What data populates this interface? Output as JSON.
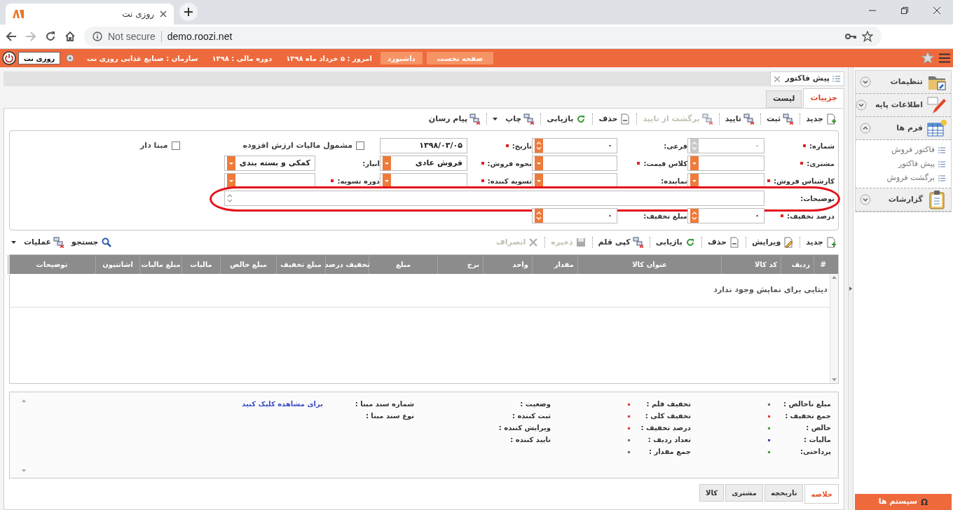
{
  "browser": {
    "tab_title": "روزی نت",
    "security": "Not secure",
    "url": "demo.roozi.net"
  },
  "header": {
    "nav_buttons": [
      {
        "label": "صفحه نخست"
      },
      {
        "label": "داشبورد"
      }
    ],
    "info": [
      "امروز : ۵ خرداد ماه ۱۳۹۸",
      "دوره مالی : ۱۳۹۸",
      "سازمان : صنایع غذایی روزی نت"
    ],
    "user": "روزی نت"
  },
  "document_tab": {
    "title": "پیش فاکتور"
  },
  "view_tabs": [
    {
      "label": "جزییات",
      "selected": true
    },
    {
      "label": "لیست",
      "selected": false
    }
  ],
  "toolbar": [
    {
      "label": "جدید",
      "kind": "new",
      "disabled": false,
      "dropdown": false
    },
    {
      "label": "ثبت",
      "kind": "network",
      "disabled": false,
      "dropdown": false
    },
    {
      "label": "تایید",
      "kind": "network",
      "disabled": false,
      "dropdown": false
    },
    {
      "label": "برگشت از تایید",
      "kind": "network",
      "disabled": true,
      "dropdown": false
    },
    {
      "label": "حذف",
      "kind": "delete",
      "disabled": false,
      "dropdown": false
    },
    {
      "label": "بازیابی",
      "kind": "refresh",
      "disabled": false,
      "dropdown": false
    },
    {
      "label": "چاپ",
      "kind": "network",
      "disabled": false,
      "dropdown": true
    },
    {
      "label": "پیام رسان",
      "kind": "network",
      "disabled": false,
      "dropdown": false
    }
  ],
  "form": {
    "rows": [
      [
        {
          "label": "شماره:",
          "required": true,
          "kind": "number",
          "value": "۰",
          "disabled": true
        },
        {
          "label": "فرعی:",
          "required": false,
          "kind": "number",
          "value": "۰",
          "disabled": false
        },
        {
          "label": "تاریخ:",
          "required": true,
          "kind": "date",
          "value": "۱۳۹۸/۰۳/۰۵"
        },
        {
          "kind": "checkbox",
          "label": "مشمول مالیات ارزش افزوده",
          "checked": false
        },
        {
          "kind": "checkbox",
          "label": "مبنا دار",
          "checked": false
        }
      ],
      [
        {
          "label": "مشتری:",
          "required": true,
          "kind": "combo"
        },
        {
          "label": "کلاس قیمت:",
          "required": true,
          "kind": "combo"
        },
        {
          "label": "نحوه فروش:",
          "required": true,
          "kind": "combo",
          "value": "فروش عادی"
        },
        {
          "label": "انبار:",
          "required": false,
          "kind": "combo",
          "value": "کمکی و بسته بندی"
        }
      ],
      [
        {
          "label": "کارشناس فروش:",
          "required": true,
          "kind": "combo"
        },
        {
          "label": "نماینده:",
          "required": false,
          "kind": "combo"
        },
        {
          "label": "تسویه کننده:",
          "required": true,
          "kind": "combo"
        },
        {
          "label": "دوره تسویه:",
          "required": true,
          "kind": "combo"
        }
      ],
      [
        {
          "label": "توضیحات:",
          "required": false,
          "kind": "textarea"
        }
      ],
      [
        {
          "label": "درصد تخفیف:",
          "required": true,
          "kind": "number",
          "value": "۰",
          "disabled": false
        },
        {
          "label": "مبلغ تخفیف:",
          "required": false,
          "kind": "number",
          "value": "۰",
          "disabled": false
        }
      ]
    ]
  },
  "items_grid": {
    "toolbar": [
      {
        "label": "جدید",
        "kind": "new",
        "disabled": false
      },
      {
        "label": "ویرایش",
        "kind": "edit",
        "disabled": false
      },
      {
        "label": "حذف",
        "kind": "delete",
        "disabled": false
      },
      {
        "label": "بازیابی",
        "kind": "refresh",
        "disabled": false
      },
      {
        "label": "کپی قلم",
        "kind": "network",
        "disabled": false
      },
      {
        "label": "ذخیره",
        "kind": "disk",
        "disabled": true
      },
      {
        "label": "انصراف",
        "kind": "cancel",
        "disabled": true
      }
    ],
    "tools": [
      {
        "label": "جستجو",
        "kind": "search",
        "dropdown": false
      },
      {
        "label": "عملیات",
        "kind": "network",
        "dropdown": true
      }
    ],
    "columns": [
      "#",
      "ردیف",
      "کد کالا",
      "عنوان کالا",
      "مقدار",
      "واحد",
      "نرخ",
      "مبلغ",
      "تخفیف درصد",
      "مبلغ تخفیف",
      "مبلغ خالص",
      "مالیات",
      "مبلغ مالیات",
      "اشانتیون",
      "توضیحات"
    ],
    "empty_message": "دیتایی برای نمایش وجود ندارد"
  },
  "summary": {
    "columns": [
      [
        {
          "label": "مبلغ ناخالص :",
          "value": "۰",
          "color": "#707070"
        },
        {
          "label": "جمع تخفیف :",
          "value": "۰",
          "color": "#e53935"
        },
        {
          "label": "خالص :",
          "value": "۰",
          "color": "#43a047"
        },
        {
          "label": "مالیات :",
          "value": "۰",
          "color": "#3949ab"
        },
        {
          "label": "پرداختی:",
          "value": "۰",
          "color": "#43a047"
        }
      ],
      [
        {
          "label": "تخفیف قلم :",
          "value": "۰",
          "color": "#e53935"
        },
        {
          "label": "تخفیف کلی :",
          "value": "۰",
          "color": "#e53935"
        },
        {
          "label": "درصد تخفیف :",
          "value": "۰",
          "color": "#e53935"
        },
        {
          "label": "تعداد ردیف :",
          "value": "۰",
          "color": "#707070"
        },
        {
          "label": "جمع مقدار :",
          "value": "۰",
          "color": "#707070"
        }
      ],
      [
        {
          "label": "وضعیت :"
        },
        {
          "label": "ثبت کننده :"
        },
        {
          "label": "ویرایش کننده :"
        },
        {
          "label": "تایید کننده :"
        }
      ],
      [
        {
          "label": "شماره سند مبنا :",
          "link": "برای مشاهده کلیک کنید"
        },
        {
          "label": "نوع سند مبنا :"
        }
      ]
    ]
  },
  "bottom_tabs": [
    {
      "label": "خلاصه",
      "selected": true
    },
    {
      "label": "تاریخچه",
      "selected": false
    },
    {
      "label": "مشتری",
      "selected": false
    },
    {
      "label": "کالا",
      "selected": false
    }
  ],
  "sidebar": {
    "sections": [
      {
        "label": "تنظیمات",
        "kind": "settings",
        "expanded": false
      },
      {
        "label": "اطلاعات پایه",
        "kind": "basic",
        "expanded": false
      },
      {
        "label": "فرم ها",
        "kind": "forms",
        "expanded": true,
        "children": [
          {
            "label": "فاکتور فروش"
          },
          {
            "label": "پیش فاکتور"
          },
          {
            "label": "برگشت فروش"
          }
        ]
      },
      {
        "label": "گزارشات",
        "kind": "reports",
        "expanded": false
      }
    ],
    "footer_button": {
      "icon": "Ω",
      "label": "سیستم ها"
    }
  }
}
